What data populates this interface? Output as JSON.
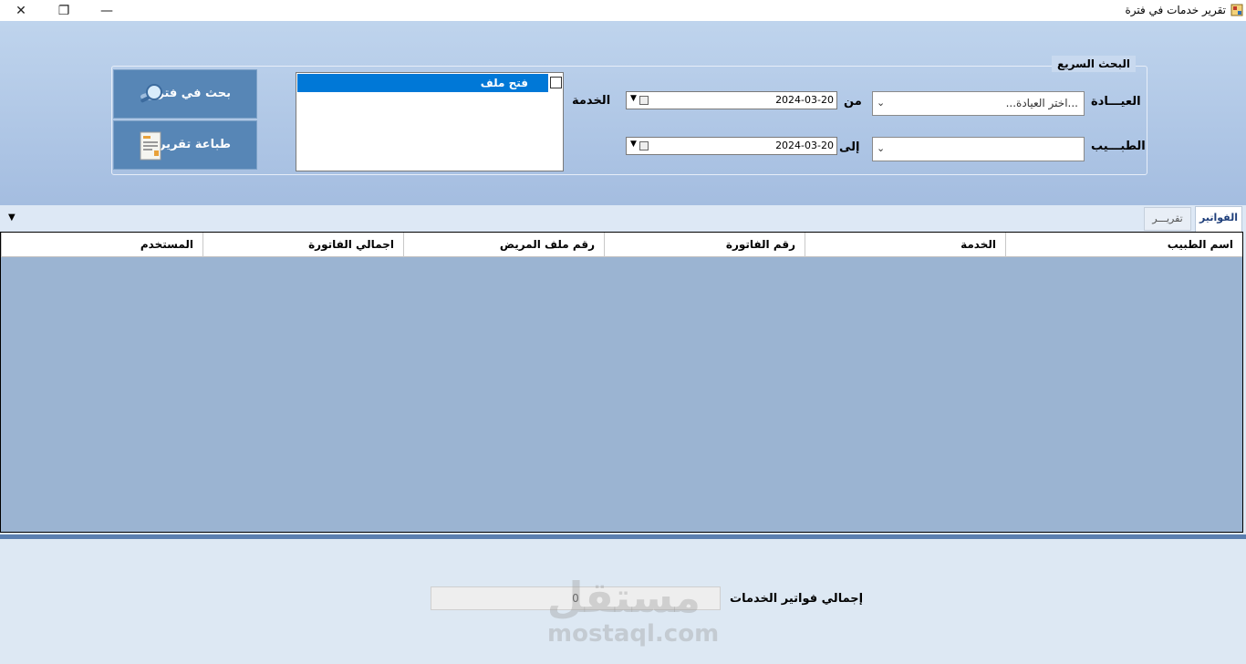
{
  "window": {
    "title": "تقرير خدمات في فترة",
    "controls": {
      "close": "✕",
      "maximize": "❐",
      "minimize": "—"
    }
  },
  "quick_search": {
    "title": "البحث السريع",
    "clinic_label": "العيـــادة",
    "clinic_value": "...اختر العيادة...",
    "doctor_label": "الطبـــيب",
    "doctor_value": "",
    "from_label": "من",
    "from_date": "2024-03-20",
    "to_label": "إلى",
    "to_date": "2024-03-20",
    "service_label": "الخدمة",
    "services": [
      {
        "label": "فتح ملف",
        "checked": false,
        "selected": true
      }
    ]
  },
  "buttons": {
    "search_period": "بحث في فترة",
    "print_report": "طباعة تقرير"
  },
  "tabs": [
    {
      "label": "الفواتير",
      "active": true
    },
    {
      "label": "تقريـــر",
      "active": false
    }
  ],
  "grid": {
    "columns": [
      "اسم الطبيب",
      "الخدمة",
      "رقم الفاتورة",
      "رقم ملف المريض",
      "اجمالي الفاتورة",
      "المستخدم"
    ],
    "rows": []
  },
  "totals": {
    "label": "إجمالي فواتير الخدمات",
    "value": "0"
  },
  "watermark": {
    "arabic": "مستقل",
    "english": "mostaql.com"
  },
  "colors": {
    "selection": "#0078d7",
    "button": "#5786b6",
    "grid_bg": "#9bb4d2"
  }
}
